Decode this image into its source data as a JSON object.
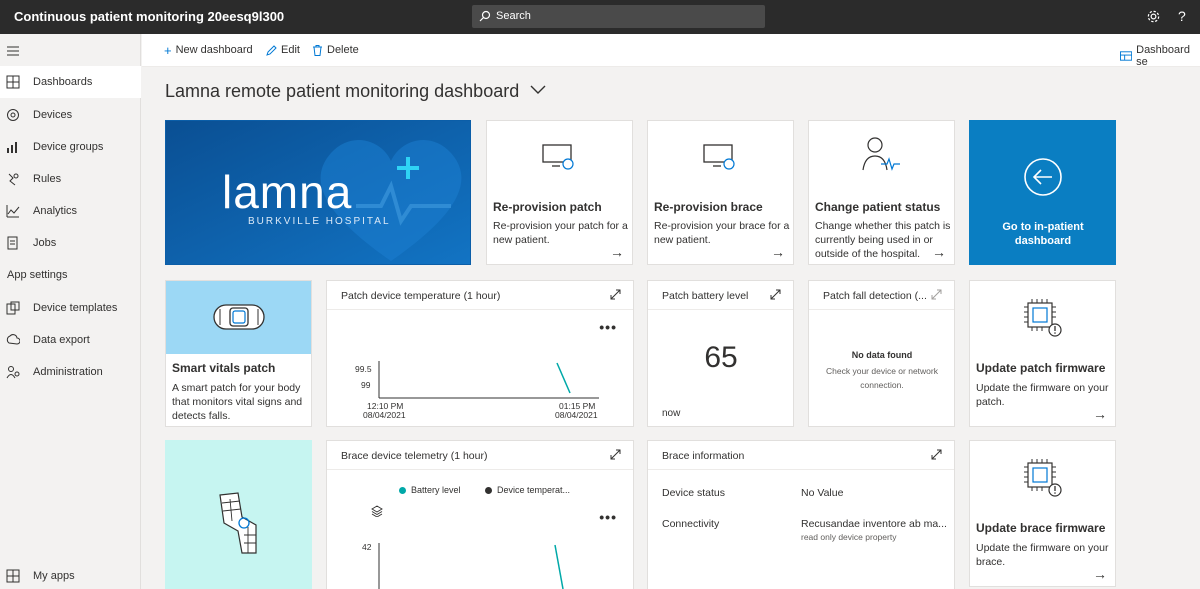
{
  "app": {
    "title": "Continuous patient monitoring 20eesq9l300",
    "search_placeholder": "Search",
    "help": "?"
  },
  "sidebar": {
    "items": [
      {
        "label": "Dashboards"
      },
      {
        "label": "Devices"
      },
      {
        "label": "Device groups"
      },
      {
        "label": "Rules"
      },
      {
        "label": "Analytics"
      },
      {
        "label": "Jobs"
      }
    ],
    "section_label": "App settings",
    "settings_items": [
      {
        "label": "Device templates"
      },
      {
        "label": "Data export"
      },
      {
        "label": "Administration"
      }
    ],
    "bottom_item": {
      "label": "My apps"
    }
  },
  "toolbar": {
    "new_dashboard": "New dashboard",
    "edit": "Edit",
    "delete": "Delete",
    "dashboard_settings": "Dashboard se"
  },
  "page": {
    "title": "Lamna remote patient monitoring dashboard"
  },
  "tiles": {
    "logo": {
      "brand": "lamna",
      "sub": "BURKVILLE HOSPITAL"
    },
    "reprovision_patch": {
      "title": "Re-provision patch",
      "desc": "Re-provision your patch for a new patient."
    },
    "reprovision_brace": {
      "title": "Re-provision brace",
      "desc": "Re-provision your brace for a new patient."
    },
    "change_status": {
      "title": "Change patient status",
      "desc": "Change whether this patch is currently being used in or outside of the hospital."
    },
    "inpatient": {
      "title": "Go to in-patient dashboard"
    },
    "smart_vitals": {
      "title": "Smart vitals patch",
      "desc": "A smart patch for your body that monitors vital signs and detects falls."
    },
    "patch_temp": {
      "title": "Patch device temperature (1 hour)",
      "y_ticks": [
        "99.5",
        "99"
      ],
      "x_ticks": [
        {
          "time": "12:10 PM",
          "date": "08/04/2021"
        },
        {
          "time": "01:15 PM",
          "date": "08/04/2021"
        }
      ]
    },
    "battery": {
      "title": "Patch battery level",
      "value": "65",
      "note": "now"
    },
    "fall": {
      "title": "Patch fall detection (...",
      "nodata_title": "No data found",
      "nodata_desc": "Check your device or network connection."
    },
    "update_patch": {
      "title": "Update patch firmware",
      "desc": "Update the firmware on your patch."
    },
    "brace_telemetry": {
      "title": "Brace device telemetry (1 hour)",
      "legend": [
        {
          "name": "Battery level",
          "color": "#00a8a8"
        },
        {
          "name": "Device temperat...",
          "color": "#323130"
        }
      ],
      "y_tick": "42"
    },
    "brace_info": {
      "title": "Brace information",
      "rows": [
        {
          "label": "Device status",
          "value": "No Value",
          "sub": ""
        },
        {
          "label": "Connectivity",
          "value": "Recusandae inventore ab ma...",
          "sub": "read only device property"
        }
      ]
    },
    "update_brace": {
      "title": "Update brace firmware",
      "desc": "Update the firmware on your brace."
    }
  },
  "chart_data": [
    {
      "type": "line",
      "title": "Patch device temperature (1 hour)",
      "x": [
        "12:10 PM 08/04/2021",
        "01:15 PM 08/04/2021"
      ],
      "series": [
        {
          "values": [
            99.6,
            98.8
          ]
        }
      ],
      "y_ticks": [
        99,
        99.5
      ]
    },
    {
      "type": "line",
      "title": "Brace device telemetry (1 hour)",
      "series": [
        {
          "name": "Battery level",
          "values": []
        },
        {
          "name": "Device temperat...",
          "values": []
        }
      ],
      "y_ticks": [
        42
      ]
    }
  ]
}
